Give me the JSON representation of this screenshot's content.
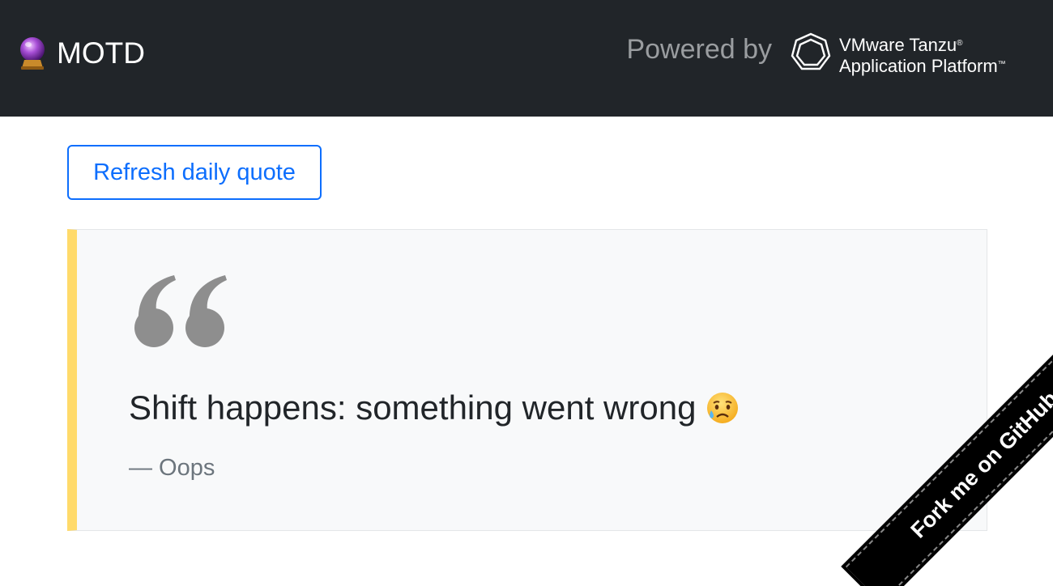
{
  "navbar": {
    "brand_label": "MOTD",
    "brand_icon": "crystal-ball-icon",
    "powered_by": "Powered by",
    "tanzu_line1": "VMware Tanzu",
    "tanzu_line1_mark": "®",
    "tanzu_line2": "Application Platform",
    "tanzu_line2_mark": "™",
    "tanzu_icon": "tanzu-heptagon-icon"
  },
  "actions": {
    "refresh_label": "Refresh daily quote"
  },
  "quote": {
    "text": "Shift happens: something went wrong",
    "emoji": "sad-sweat-face-icon",
    "author": "— Oops",
    "accent_color": "#ffda6a"
  },
  "ribbon": {
    "label": "Fork me on GitHub"
  },
  "colors": {
    "navbar_bg": "#212529",
    "primary": "#0d6efd",
    "card_bg": "#f8f9fa",
    "muted": "#6c757d"
  }
}
